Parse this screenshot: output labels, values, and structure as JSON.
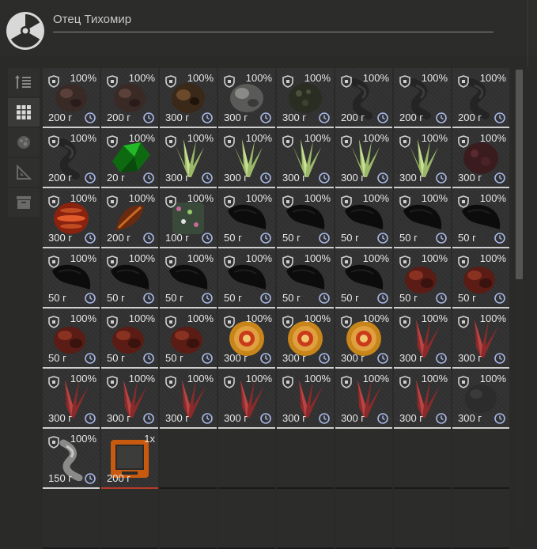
{
  "window": {
    "title": "Отец Тихомир"
  },
  "sidebar": {
    "items": [
      {
        "icon": "sort-icon",
        "active": false
      },
      {
        "icon": "grid-icon",
        "active": true
      },
      {
        "icon": "artifact-icon",
        "active": false
      },
      {
        "icon": "ruler-icon",
        "active": false
      },
      {
        "icon": "box-icon",
        "active": false
      }
    ]
  },
  "inventory": {
    "items": [
      {
        "price": "200 г",
        "pct": "100%",
        "kind": "dark-rock"
      },
      {
        "price": "200 г",
        "pct": "100%",
        "kind": "dark-rock"
      },
      {
        "price": "300 г",
        "pct": "100%",
        "kind": "orange-rock"
      },
      {
        "price": "300 г",
        "pct": "100%",
        "kind": "gray-rock"
      },
      {
        "price": "300 г",
        "pct": "100%",
        "kind": "moss-rock"
      },
      {
        "price": "200 г",
        "pct": "100%",
        "kind": "twisted"
      },
      {
        "price": "200 г",
        "pct": "100%",
        "kind": "twisted"
      },
      {
        "price": "200 г",
        "pct": "100%",
        "kind": "twisted"
      },
      {
        "price": "200 г",
        "pct": "100%",
        "kind": "twisted"
      },
      {
        "price": "20 г",
        "pct": "100%",
        "kind": "green-crystal"
      },
      {
        "price": "300 г",
        "pct": "100%",
        "kind": "green-spikes"
      },
      {
        "price": "300 г",
        "pct": "100%",
        "kind": "green-spikes"
      },
      {
        "price": "300 г",
        "pct": "100%",
        "kind": "green-spikes"
      },
      {
        "price": "300 г",
        "pct": "100%",
        "kind": "green-spikes"
      },
      {
        "price": "300 г",
        "pct": "100%",
        "kind": "green-spikes"
      },
      {
        "price": "300 г",
        "pct": "100%",
        "kind": "red-rock"
      },
      {
        "price": "300 г",
        "pct": "100%",
        "kind": "red-ball"
      },
      {
        "price": "200 г",
        "pct": "100%",
        "kind": "red-leaf"
      },
      {
        "price": "100 г",
        "pct": "100%",
        "kind": "speckled"
      },
      {
        "price": "50 г",
        "pct": "100%",
        "kind": "black-shard"
      },
      {
        "price": "50 г",
        "pct": "100%",
        "kind": "black-shard"
      },
      {
        "price": "50 г",
        "pct": "100%",
        "kind": "black-shard"
      },
      {
        "price": "50 г",
        "pct": "100%",
        "kind": "black-shard"
      },
      {
        "price": "50 г",
        "pct": "100%",
        "kind": "black-shard"
      },
      {
        "price": "50 г",
        "pct": "100%",
        "kind": "black-shard"
      },
      {
        "price": "50 г",
        "pct": "100%",
        "kind": "black-shard"
      },
      {
        "price": "50 г",
        "pct": "100%",
        "kind": "black-shard"
      },
      {
        "price": "50 г",
        "pct": "100%",
        "kind": "black-shard"
      },
      {
        "price": "50 г",
        "pct": "100%",
        "kind": "black-shard"
      },
      {
        "price": "50 г",
        "pct": "100%",
        "kind": "black-shard"
      },
      {
        "price": "50 г",
        "pct": "100%",
        "kind": "red-clump"
      },
      {
        "price": "50 г",
        "pct": "100%",
        "kind": "red-clump"
      },
      {
        "price": "50 г",
        "pct": "100%",
        "kind": "red-clump"
      },
      {
        "price": "50 г",
        "pct": "100%",
        "kind": "red-clump"
      },
      {
        "price": "50 г",
        "pct": "100%",
        "kind": "red-clump"
      },
      {
        "price": "300 г",
        "pct": "100%",
        "kind": "swirl"
      },
      {
        "price": "300 г",
        "pct": "100%",
        "kind": "swirl"
      },
      {
        "price": "300 г",
        "pct": "100%",
        "kind": "swirl"
      },
      {
        "price": "300 г",
        "pct": "100%",
        "kind": "red-spikes"
      },
      {
        "price": "300 г",
        "pct": "100%",
        "kind": "red-spikes"
      },
      {
        "price": "300 г",
        "pct": "100%",
        "kind": "red-spikes"
      },
      {
        "price": "300 г",
        "pct": "100%",
        "kind": "red-spikes"
      },
      {
        "price": "300 г",
        "pct": "100%",
        "kind": "red-spikes"
      },
      {
        "price": "300 г",
        "pct": "100%",
        "kind": "red-spikes"
      },
      {
        "price": "300 г",
        "pct": "100%",
        "kind": "red-spikes"
      },
      {
        "price": "300 г",
        "pct": "100%",
        "kind": "red-spikes"
      },
      {
        "price": "300 г",
        "pct": "100%",
        "kind": "red-spikes"
      },
      {
        "price": "300 г",
        "pct": "100%",
        "kind": "dark-gray"
      },
      {
        "price": "150 г",
        "pct": "100%",
        "kind": "silver"
      },
      {
        "price": "200 г",
        "pct": "1x",
        "kind": "pda"
      }
    ]
  },
  "colors": {
    "accent": "#cfcfcf",
    "background": "#2a2a28"
  }
}
